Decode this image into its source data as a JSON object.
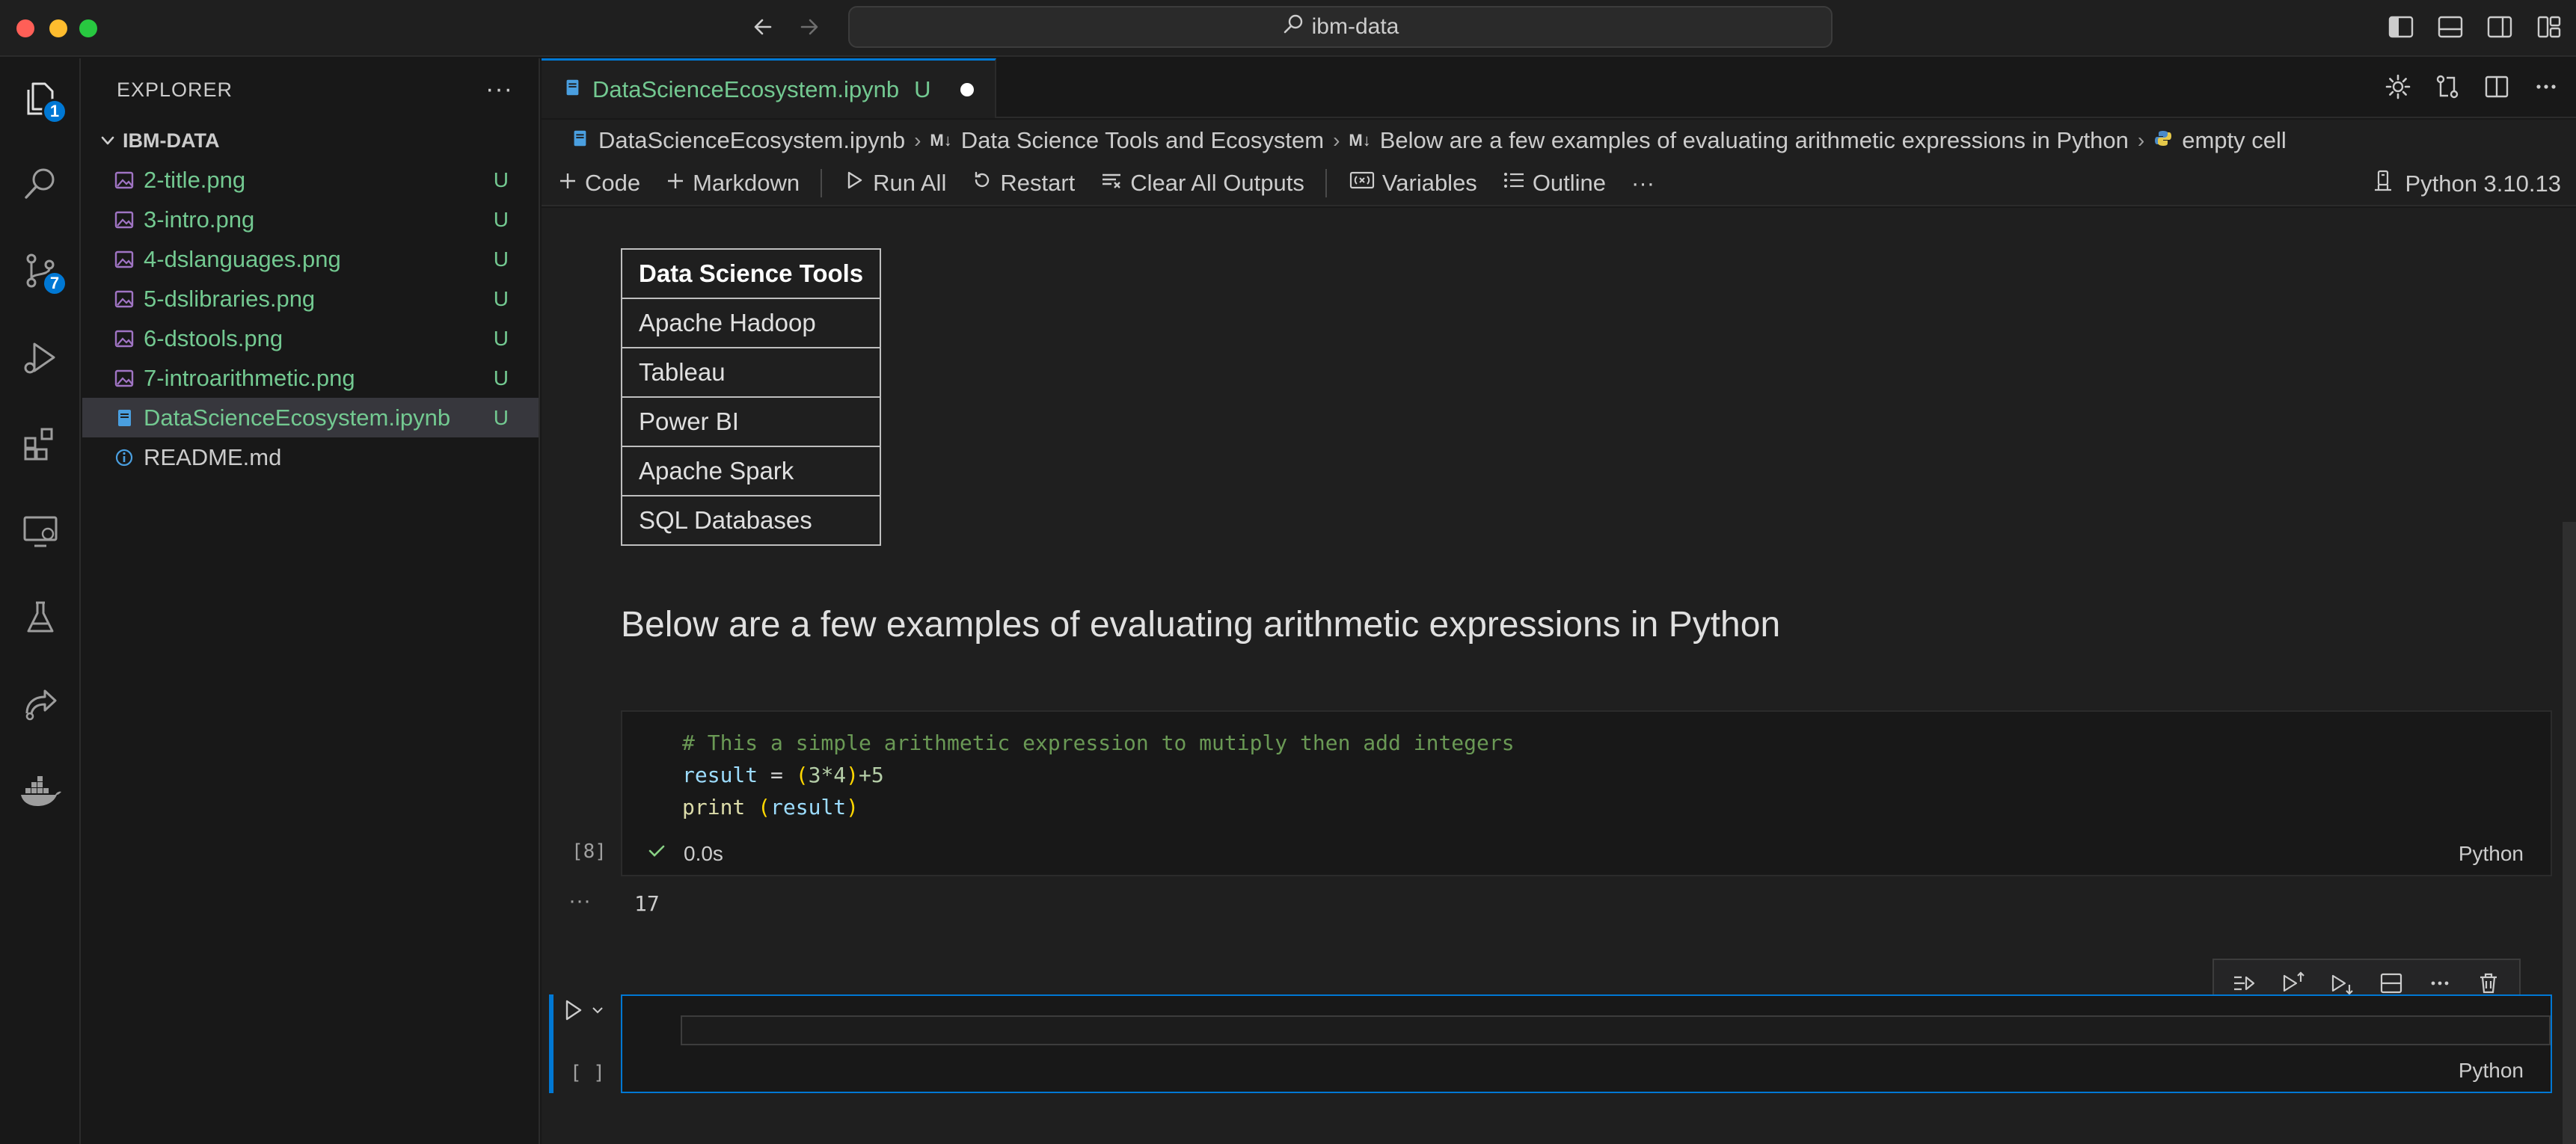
{
  "titlebar": {
    "search_text": "ibm-data"
  },
  "activity": {
    "explorer_badge": "1",
    "scm_badge": "7"
  },
  "explorer": {
    "header": "EXPLORER",
    "folder": "IBM-DATA",
    "files": [
      {
        "name": "2-title.png",
        "status": "U"
      },
      {
        "name": "3-intro.png",
        "status": "U"
      },
      {
        "name": "4-dslanguages.png",
        "status": "U"
      },
      {
        "name": "5-dslibraries.png",
        "status": "U"
      },
      {
        "name": "6-dstools.png",
        "status": "U"
      },
      {
        "name": "7-introarithmetic.png",
        "status": "U"
      },
      {
        "name": "DataScienceEcosystem.ipynb",
        "status": "U"
      },
      {
        "name": "README.md",
        "status": ""
      }
    ]
  },
  "tab": {
    "title": "DataScienceEcosystem.ipynb",
    "status": "U"
  },
  "breadcrumb": {
    "file": "DataScienceEcosystem.ipynb",
    "md_tag": "M↓",
    "section1": "Data Science Tools and Ecosystem",
    "section2": "Below are a few examples of evaluating arithmetic expressions in Python",
    "cell": "empty cell"
  },
  "toolbar": {
    "code": "Code",
    "markdown": "Markdown",
    "run_all": "Run All",
    "restart": "Restart",
    "clear_outputs": "Clear All Outputs",
    "variables": "Variables",
    "outline": "Outline",
    "more": "···",
    "kernel": "Python 3.10.13"
  },
  "table": {
    "header": "Data Science Tools",
    "rows": [
      "Apache Hadoop",
      "Tableau",
      "Power BI",
      "Apache Spark",
      "SQL Databases"
    ]
  },
  "markdown_heading": "Below are a few examples of evaluating arithmetic expressions in Python",
  "code_cell": {
    "comment": "# This a simple arithmetic expression to mutiply then add integers",
    "line2_var": "result",
    "line2_eq": " = ",
    "line2_open": "(",
    "line2_expr": "3*4",
    "line2_close": ")",
    "line2_tail": "+5",
    "line3_func": "print ",
    "line3_open": "(",
    "line3_arg": "result",
    "line3_close": ")",
    "exec_count": "[8]",
    "duration": "0.0s",
    "language": "Python",
    "output": "17",
    "output_dots": "···"
  },
  "empty_cell": {
    "exec_count": "[ ]",
    "language": "Python"
  }
}
